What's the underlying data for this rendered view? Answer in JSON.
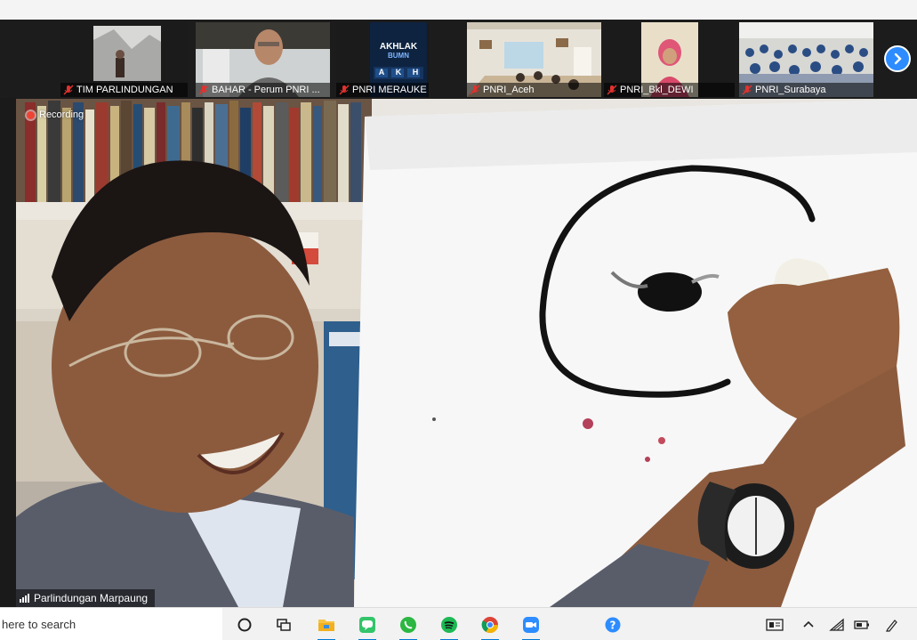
{
  "gallery": {
    "participants": [
      {
        "name": "TIM PARLINDUNGAN",
        "muted": true
      },
      {
        "name": "BAHAR - Perum PNRI ...",
        "muted": true
      },
      {
        "name": "PNRI MERAUKE",
        "muted": true
      },
      {
        "name": "PNRI_Aceh",
        "muted": true
      },
      {
        "name": "PNRI_Bkl_DEWI",
        "muted": true
      },
      {
        "name": "PNRI_Surabaya",
        "muted": true
      }
    ],
    "poster": {
      "line1": "AKHLAK",
      "line2": "BUMN",
      "letters": [
        "A",
        "K",
        "H"
      ]
    }
  },
  "stage": {
    "recording_label": "Recording",
    "speaker_name": "Parlindungan Marpaung"
  },
  "taskbar": {
    "search_placeholder": "here to search",
    "apps": [
      {
        "icon": "cortana-icon"
      },
      {
        "icon": "task-view-icon"
      },
      {
        "icon": "file-explorer-icon"
      },
      {
        "icon": "line-messenger-icon"
      },
      {
        "icon": "whatsapp-icon"
      },
      {
        "icon": "spotify-icon"
      },
      {
        "icon": "chrome-icon"
      },
      {
        "icon": "zoom-icon"
      },
      {
        "icon": "help-icon"
      }
    ],
    "tray": [
      {
        "icon": "news-icon"
      },
      {
        "icon": "chevron-up-icon"
      },
      {
        "icon": "wifi-icon"
      },
      {
        "icon": "battery-icon"
      },
      {
        "icon": "pen-icon"
      }
    ]
  },
  "colors": {
    "zoom_blue": "#2d8cff",
    "mute_red": "#e0322f",
    "taskbar_bg": "#f2f2f2"
  }
}
